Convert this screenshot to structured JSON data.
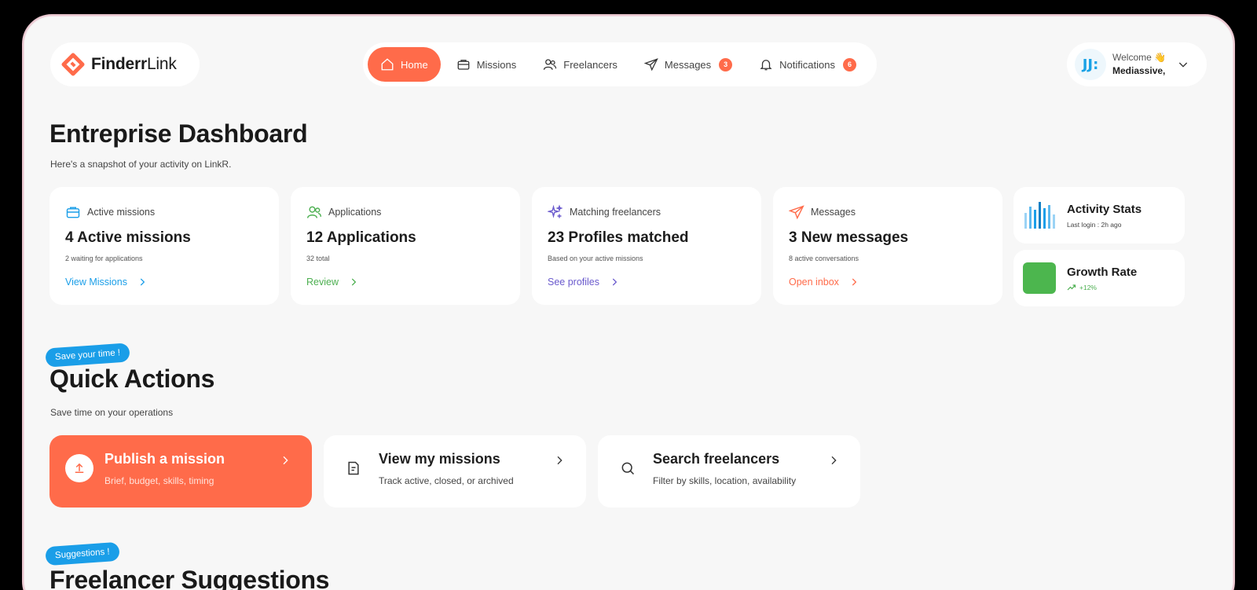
{
  "brand": {
    "name_bold": "Finderr",
    "name_light": "Link",
    "accent": "#ff6b4a"
  },
  "nav": {
    "items": [
      {
        "label": "Home",
        "icon": "home-icon",
        "active": true
      },
      {
        "label": "Missions",
        "icon": "briefcase-icon"
      },
      {
        "label": "Freelancers",
        "icon": "users-icon"
      },
      {
        "label": "Messages",
        "icon": "send-icon",
        "badge": "3"
      },
      {
        "label": "Notifications",
        "icon": "bell-icon",
        "badge": "6"
      }
    ]
  },
  "user": {
    "avatar": "JJ:",
    "welcome": "Welcome 👋",
    "name": "Mediassive,"
  },
  "dashboard": {
    "title": "Entreprise Dashboard",
    "subtitle": "Here's a snapshot of your activity on LinkR."
  },
  "stats": [
    {
      "label": "Active missions",
      "value": "4 Active missions",
      "note": "2 waiting for applications",
      "link": "View Missions",
      "color": "#1a9ee8",
      "icon": "briefcase-icon"
    },
    {
      "label": "Applications",
      "value": "12 Applications",
      "note": "32 total",
      "link": "Review",
      "color": "#4caf50",
      "icon": "users-icon"
    },
    {
      "label": "Matching freelancers",
      "value": "23 Profiles matched",
      "note": "Based on your active missions",
      "link": "See profiles",
      "color": "#6a5acd",
      "icon": "sparkles-icon"
    },
    {
      "label": "Messages",
      "value": "3 New messages",
      "note": "8 active conversations",
      "link": "Open inbox",
      "color": "#ff6b4a",
      "icon": "send-icon"
    }
  ],
  "activity": {
    "title": "Activity Stats",
    "sub": "Last login : 2h ago"
  },
  "growth": {
    "title": "Growth Rate",
    "sub": "+12%"
  },
  "quick": {
    "tag": "Save your time !",
    "title": "Quick Actions",
    "subtitle": "Save time on your operations",
    "actions": [
      {
        "title": "Publish a mission",
        "desc": "Brief, budget, skills, timing",
        "icon": "upload-icon"
      },
      {
        "title": "View my missions",
        "desc": "Track active, closed, or archived",
        "icon": "document-icon"
      },
      {
        "title": "Search freelancers",
        "desc": "Filter by skills, location, availability",
        "icon": "search-icon"
      }
    ]
  },
  "suggestions": {
    "tag": "Suggestions !",
    "title": "Freelancer Suggestions"
  }
}
